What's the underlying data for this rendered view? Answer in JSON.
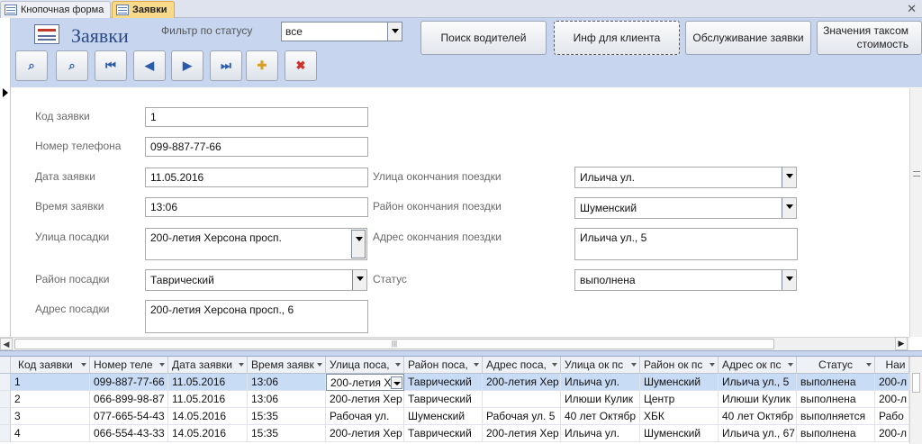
{
  "tabs": [
    {
      "label": "Кнопочная форма"
    },
    {
      "label": "Заявки"
    }
  ],
  "header": {
    "title": "Заявки",
    "filter_label": "Фильтр по статусу",
    "filter_value": "все",
    "buttons": {
      "search_drivers": "Поиск водителей",
      "client_info": "Инф для клиента",
      "request_service": "Обслуживание заявки",
      "taxometer_line1": "Значения таксом",
      "taxometer_line2": "стоимость"
    },
    "nav_icons": [
      "find-icon",
      "find-replace-icon",
      "first-record-icon",
      "prev-record-icon",
      "next-record-icon",
      "last-record-icon",
      "new-record-icon",
      "delete-record-icon"
    ]
  },
  "form": {
    "labels": {
      "id": "Код заявки",
      "phone": "Номер телефона",
      "date": "Дата заявки",
      "time": "Время заявки",
      "pickup_street": "Улица посадки",
      "pickup_district": "Район посадки",
      "pickup_address": "Адрес посадки",
      "end_street": "Улица окончания поездки",
      "end_district": "Район окончания поездки",
      "end_address": "Адрес окончания поездки",
      "status": "Статус"
    },
    "values": {
      "id": "1",
      "phone": "099-887-77-66",
      "date": "11.05.2016",
      "time": "13:06",
      "pickup_street": "200-летия Херсона просп.",
      "pickup_district": "Таврический",
      "pickup_address": "200-летия Херсона просп., 6",
      "end_street": "Ильича ул.",
      "end_district": "Шуменский",
      "end_address": "Ильича ул., 5",
      "status": "выполнена"
    }
  },
  "grid": {
    "headers": [
      "Код заявки",
      "Номер теле",
      "Дата заявки",
      "Время заявк",
      "Улица поса,",
      "Район поса,",
      "Адрес поса,",
      "Улица ок пс",
      "Район ок пс",
      "Адрес ок пс",
      "Статус",
      "Наи"
    ],
    "rows": [
      [
        "1",
        "099-887-77-66",
        "11.05.2016",
        "13:06",
        "200-летия Х",
        "Таврический",
        "200-летия Хер",
        "Ильича ул.",
        "Шуменский",
        "Ильича ул., 5",
        "выполнена",
        "200-л"
      ],
      [
        "2",
        "066-899-98-87",
        "11.05.2016",
        "13:06",
        "200-летия Хер",
        "Таврический",
        "",
        "Илюши Кулик",
        "Центр",
        "Илюши Кулик",
        "выполнена",
        "200-л"
      ],
      [
        "3",
        "077-665-54-43",
        "14.05.2016",
        "15:35",
        "Рабочая ул.",
        "Шуменский",
        "Рабочая ул. 5",
        "40 лет Октябр",
        "ХБК",
        "40 лет Октябр",
        "выполняется",
        "Рабо"
      ],
      [
        "4",
        "066-554-43-33",
        "14.05.2016",
        "15:35",
        "200-летия Хер",
        "Таврический",
        "200-летия Хер",
        "Ильича ул.",
        "Шуменский",
        "Ильича ул., 67",
        "выполнена",
        "200-л"
      ]
    ]
  }
}
